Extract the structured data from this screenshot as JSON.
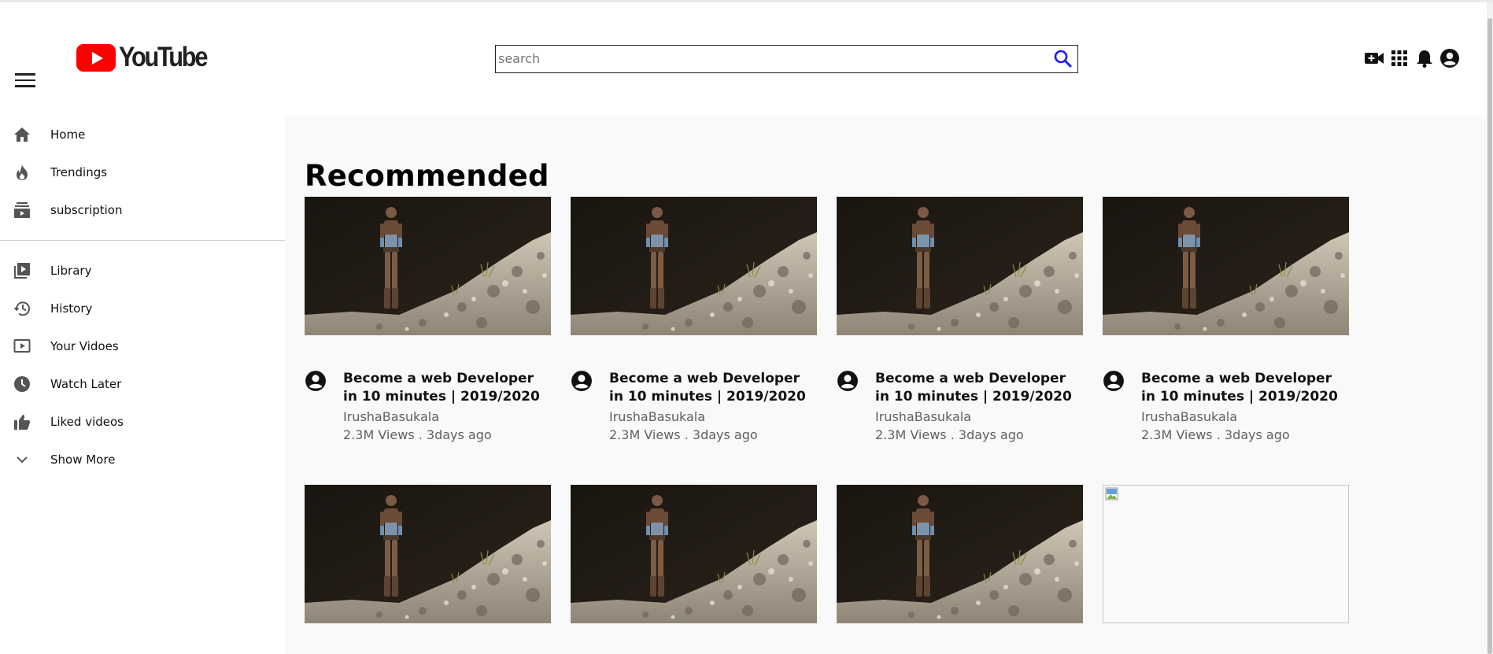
{
  "header": {
    "logo_text": "YouTube",
    "search_placeholder": "search",
    "search_value": "",
    "icons": [
      "menu-icon",
      "search-icon",
      "video-camera-add-icon",
      "apps-grid-icon",
      "notification-bell-icon",
      "account-circle-icon"
    ]
  },
  "sidebar": {
    "primary": [
      {
        "label": "Home",
        "icon": "home-icon"
      },
      {
        "label": "Trendings",
        "icon": "fire-icon"
      },
      {
        "label": "subscription",
        "icon": "subscriptions-icon"
      }
    ],
    "secondary": [
      {
        "label": "Library",
        "icon": "library-icon"
      },
      {
        "label": "History",
        "icon": "history-icon"
      },
      {
        "label": "Your Vidoes",
        "icon": "your-videos-icon"
      },
      {
        "label": "Watch Later",
        "icon": "clock-icon"
      },
      {
        "label": "Liked videos",
        "icon": "thumbs-up-icon"
      },
      {
        "label": "Show More",
        "icon": "chevron-down-icon"
      }
    ]
  },
  "main": {
    "heading": "Recommended",
    "videos": [
      {
        "title": "Become a web Developer in 10 minutes | 2019/2020",
        "channel": "IrushaBasukala",
        "stats": "2.3M Views . 3days ago"
      },
      {
        "title": "Become a web Developer in 10 minutes | 2019/2020",
        "channel": "IrushaBasukala",
        "stats": "2.3M Views . 3days ago"
      },
      {
        "title": "Become a web Developer in 10 minutes | 2019/2020",
        "channel": "IrushaBasukala",
        "stats": "2.3M Views . 3days ago"
      },
      {
        "title": "Become a web Developer in 10 minutes | 2019/2020",
        "channel": "IrushaBasukala",
        "stats": "2.3M Views . 3days ago"
      }
    ],
    "second_row_thumbnails": 4,
    "second_row_broken_index": 3
  },
  "colors": {
    "brand_red": "#ff0000",
    "search_icon_blue": "#1a1aff",
    "main_background": "#f9f9f9",
    "secondary_text": "#606060"
  }
}
